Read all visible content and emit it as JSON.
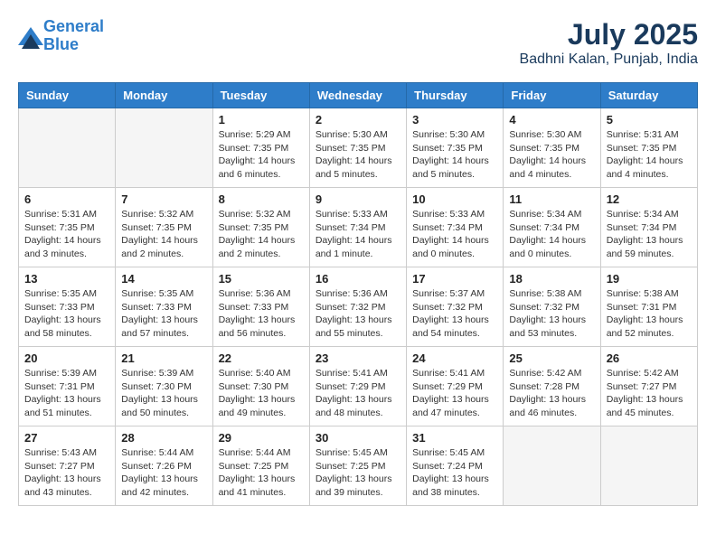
{
  "header": {
    "logo_line1": "General",
    "logo_line2": "Blue",
    "month_title": "July 2025",
    "location": "Badhni Kalan, Punjab, India"
  },
  "weekdays": [
    "Sunday",
    "Monday",
    "Tuesday",
    "Wednesday",
    "Thursday",
    "Friday",
    "Saturday"
  ],
  "weeks": [
    [
      {
        "day": "",
        "info": ""
      },
      {
        "day": "",
        "info": ""
      },
      {
        "day": "1",
        "info": "Sunrise: 5:29 AM\nSunset: 7:35 PM\nDaylight: 14 hours\nand 6 minutes."
      },
      {
        "day": "2",
        "info": "Sunrise: 5:30 AM\nSunset: 7:35 PM\nDaylight: 14 hours\nand 5 minutes."
      },
      {
        "day": "3",
        "info": "Sunrise: 5:30 AM\nSunset: 7:35 PM\nDaylight: 14 hours\nand 5 minutes."
      },
      {
        "day": "4",
        "info": "Sunrise: 5:30 AM\nSunset: 7:35 PM\nDaylight: 14 hours\nand 4 minutes."
      },
      {
        "day": "5",
        "info": "Sunrise: 5:31 AM\nSunset: 7:35 PM\nDaylight: 14 hours\nand 4 minutes."
      }
    ],
    [
      {
        "day": "6",
        "info": "Sunrise: 5:31 AM\nSunset: 7:35 PM\nDaylight: 14 hours\nand 3 minutes."
      },
      {
        "day": "7",
        "info": "Sunrise: 5:32 AM\nSunset: 7:35 PM\nDaylight: 14 hours\nand 2 minutes."
      },
      {
        "day": "8",
        "info": "Sunrise: 5:32 AM\nSunset: 7:35 PM\nDaylight: 14 hours\nand 2 minutes."
      },
      {
        "day": "9",
        "info": "Sunrise: 5:33 AM\nSunset: 7:34 PM\nDaylight: 14 hours\nand 1 minute."
      },
      {
        "day": "10",
        "info": "Sunrise: 5:33 AM\nSunset: 7:34 PM\nDaylight: 14 hours\nand 0 minutes."
      },
      {
        "day": "11",
        "info": "Sunrise: 5:34 AM\nSunset: 7:34 PM\nDaylight: 14 hours\nand 0 minutes."
      },
      {
        "day": "12",
        "info": "Sunrise: 5:34 AM\nSunset: 7:34 PM\nDaylight: 13 hours\nand 59 minutes."
      }
    ],
    [
      {
        "day": "13",
        "info": "Sunrise: 5:35 AM\nSunset: 7:33 PM\nDaylight: 13 hours\nand 58 minutes."
      },
      {
        "day": "14",
        "info": "Sunrise: 5:35 AM\nSunset: 7:33 PM\nDaylight: 13 hours\nand 57 minutes."
      },
      {
        "day": "15",
        "info": "Sunrise: 5:36 AM\nSunset: 7:33 PM\nDaylight: 13 hours\nand 56 minutes."
      },
      {
        "day": "16",
        "info": "Sunrise: 5:36 AM\nSunset: 7:32 PM\nDaylight: 13 hours\nand 55 minutes."
      },
      {
        "day": "17",
        "info": "Sunrise: 5:37 AM\nSunset: 7:32 PM\nDaylight: 13 hours\nand 54 minutes."
      },
      {
        "day": "18",
        "info": "Sunrise: 5:38 AM\nSunset: 7:32 PM\nDaylight: 13 hours\nand 53 minutes."
      },
      {
        "day": "19",
        "info": "Sunrise: 5:38 AM\nSunset: 7:31 PM\nDaylight: 13 hours\nand 52 minutes."
      }
    ],
    [
      {
        "day": "20",
        "info": "Sunrise: 5:39 AM\nSunset: 7:31 PM\nDaylight: 13 hours\nand 51 minutes."
      },
      {
        "day": "21",
        "info": "Sunrise: 5:39 AM\nSunset: 7:30 PM\nDaylight: 13 hours\nand 50 minutes."
      },
      {
        "day": "22",
        "info": "Sunrise: 5:40 AM\nSunset: 7:30 PM\nDaylight: 13 hours\nand 49 minutes."
      },
      {
        "day": "23",
        "info": "Sunrise: 5:41 AM\nSunset: 7:29 PM\nDaylight: 13 hours\nand 48 minutes."
      },
      {
        "day": "24",
        "info": "Sunrise: 5:41 AM\nSunset: 7:29 PM\nDaylight: 13 hours\nand 47 minutes."
      },
      {
        "day": "25",
        "info": "Sunrise: 5:42 AM\nSunset: 7:28 PM\nDaylight: 13 hours\nand 46 minutes."
      },
      {
        "day": "26",
        "info": "Sunrise: 5:42 AM\nSunset: 7:27 PM\nDaylight: 13 hours\nand 45 minutes."
      }
    ],
    [
      {
        "day": "27",
        "info": "Sunrise: 5:43 AM\nSunset: 7:27 PM\nDaylight: 13 hours\nand 43 minutes."
      },
      {
        "day": "28",
        "info": "Sunrise: 5:44 AM\nSunset: 7:26 PM\nDaylight: 13 hours\nand 42 minutes."
      },
      {
        "day": "29",
        "info": "Sunrise: 5:44 AM\nSunset: 7:25 PM\nDaylight: 13 hours\nand 41 minutes."
      },
      {
        "day": "30",
        "info": "Sunrise: 5:45 AM\nSunset: 7:25 PM\nDaylight: 13 hours\nand 39 minutes."
      },
      {
        "day": "31",
        "info": "Sunrise: 5:45 AM\nSunset: 7:24 PM\nDaylight: 13 hours\nand 38 minutes."
      },
      {
        "day": "",
        "info": ""
      },
      {
        "day": "",
        "info": ""
      }
    ]
  ]
}
